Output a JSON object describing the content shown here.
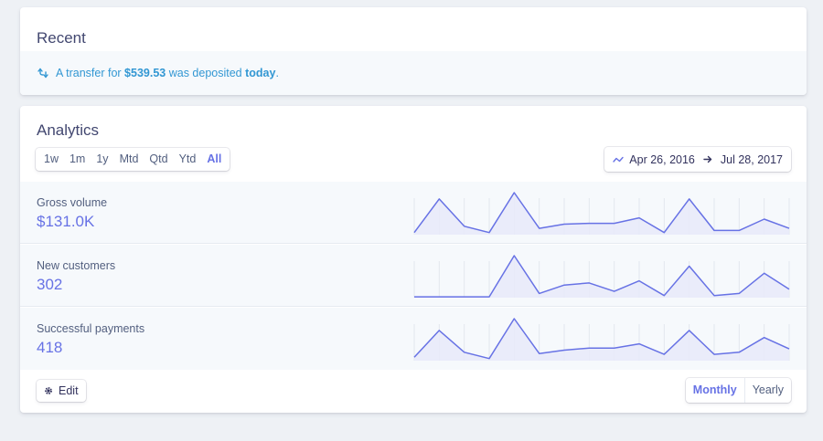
{
  "colors": {
    "accent": "#6772e5",
    "link": "#3297d3",
    "spark_fill": "#e8eaf9",
    "grid": "#e3e8ee"
  },
  "recent": {
    "title": "Recent",
    "icon": "transfer-icon",
    "message": {
      "prefix": "A transfer for ",
      "amount": "$539.53",
      "middle": " was deposited ",
      "when": "today",
      "suffix": "."
    }
  },
  "analytics": {
    "title": "Analytics",
    "ranges": [
      "1w",
      "1m",
      "1y",
      "Mtd",
      "Qtd",
      "Ytd",
      "All"
    ],
    "active_range": "All",
    "date_range": {
      "icon": "trend-line-icon",
      "from": "Apr 26, 2016",
      "to": "Jul 28, 2017"
    },
    "metrics": [
      {
        "label": "Gross volume",
        "value": "$131.0K"
      },
      {
        "label": "New customers",
        "value": "302"
      },
      {
        "label": "Successful payments",
        "value": "418"
      }
    ],
    "edit_label": "Edit",
    "periods": [
      "Monthly",
      "Yearly"
    ],
    "active_period": "Monthly"
  },
  "chart_data": [
    {
      "type": "area",
      "series": [
        {
          "values": [
            0.05,
            0.85,
            0.2,
            0.05,
            1.0,
            0.15,
            0.25,
            0.27,
            0.27,
            0.4,
            0.05,
            0.85,
            0.1,
            0.1,
            0.37,
            0.15
          ]
        }
      ]
    },
    {
      "type": "area",
      "series": [
        {
          "values": [
            0.02,
            0.02,
            0.02,
            0.02,
            1.0,
            0.1,
            0.3,
            0.35,
            0.15,
            0.4,
            0.05,
            0.75,
            0.05,
            0.1,
            0.58,
            0.2
          ]
        }
      ]
    },
    {
      "type": "area",
      "series": [
        {
          "values": [
            0.08,
            0.72,
            0.2,
            0.05,
            1.0,
            0.17,
            0.25,
            0.3,
            0.3,
            0.4,
            0.15,
            0.72,
            0.15,
            0.2,
            0.55,
            0.28
          ]
        }
      ]
    }
  ]
}
